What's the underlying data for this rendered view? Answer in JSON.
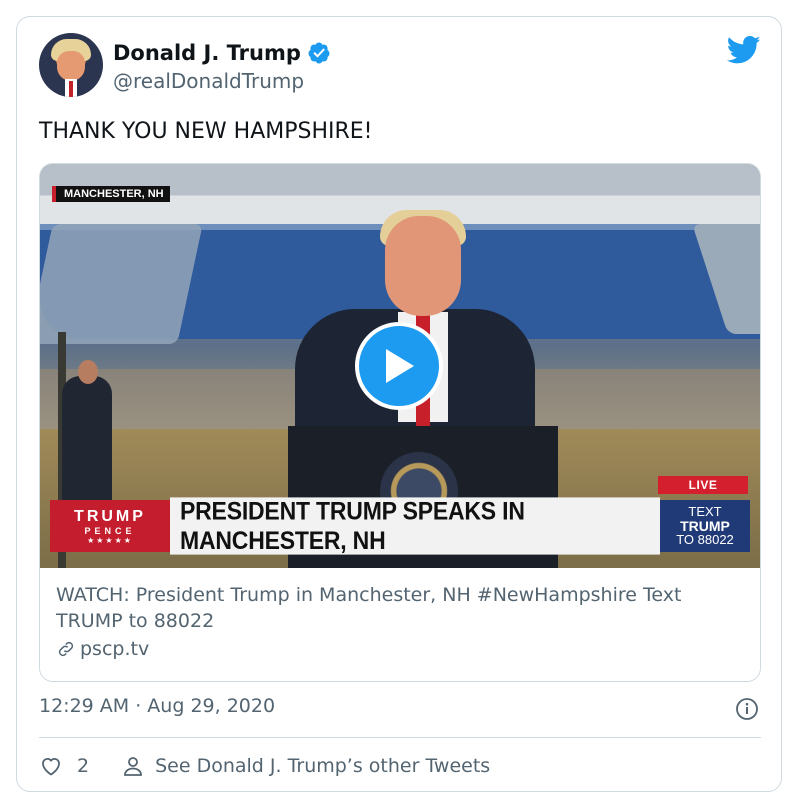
{
  "tweet": {
    "author_name": "Donald J. Trump",
    "handle": "@realDonaldTrump",
    "text": "THANK YOU NEW HAMPSHIRE!",
    "timestamp": "12:29 AM · Aug 29, 2020",
    "likes": "2",
    "other_tweets_label": "See Donald J. Trump’s other Tweets"
  },
  "video": {
    "location_tag": "MANCHESTER, NH",
    "live_label": "LIVE",
    "logo_line1": "TRUMP",
    "logo_line2": "PENCE",
    "logo_line3": "★★★★★",
    "headline": "PRESIDENT TRUMP SPEAKS IN MANCHESTER, NH",
    "text_line1": "TEXT",
    "text_line2": "TRUMP",
    "text_line3": "TO 88022"
  },
  "link_card": {
    "description": "WATCH: President Trump in Manchester, NH #NewHampshire Text TRUMP to 88022",
    "domain": "pscp.tv"
  },
  "colors": {
    "accent": "#1d9bf0",
    "text_primary": "#0f1419",
    "text_secondary": "#536471",
    "border": "#cfd9de"
  },
  "icons": {
    "verified": "verified-badge-icon",
    "brand": "twitter-bird-icon",
    "play": "play-icon",
    "link": "link-icon",
    "info": "info-icon",
    "like": "heart-icon",
    "profile": "person-icon"
  }
}
